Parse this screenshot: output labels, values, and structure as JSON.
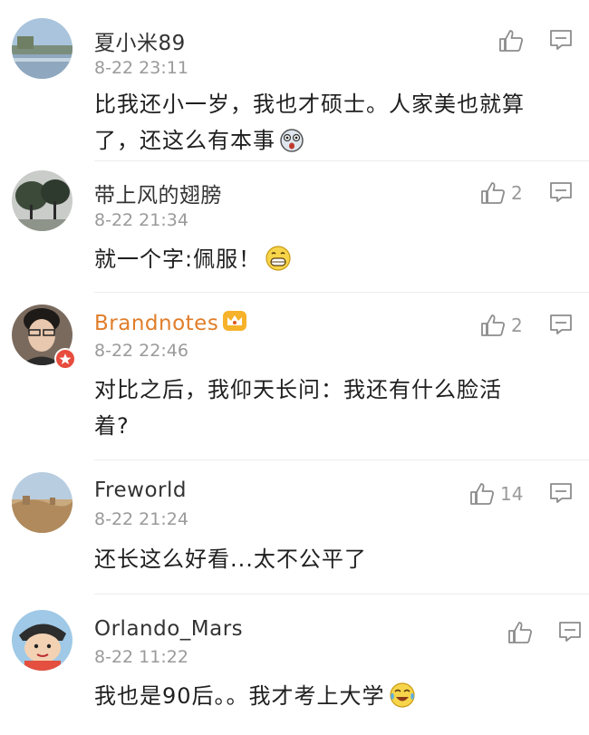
{
  "comments": [
    {
      "name": "夏小米89",
      "time": "8-22 23:11",
      "text": "比我还小一岁，我也才硕士。人家美也就算了，还这么有本事",
      "likes": "",
      "avatar": "lake-icon"
    },
    {
      "name": "带上风的翅膀",
      "time": "8-22 21:34",
      "text": "就一个字:佩服！",
      "likes": "2",
      "avatar": "trees-icon"
    },
    {
      "name": "Brandnotes",
      "time": "8-22 22:46",
      "text": "对比之后，我仰天长问：我还有什么脸活着?",
      "likes": "2",
      "avatar": "person-icon",
      "vip": true
    },
    {
      "name": "Freworld",
      "time": "8-22 21:24",
      "text": "还长这么好看...太不公平了",
      "likes": "14",
      "avatar": "desert-icon"
    },
    {
      "name": "Orlando_Mars",
      "time": "8-22 11:22",
      "text": "我也是90后。。我才考上大学",
      "likes": "",
      "avatar": "cartoon-icon"
    }
  ],
  "colors": {
    "name": "#333333",
    "vip_name": "#e07d2a",
    "time": "#9a9a9a",
    "text": "#1f1f1f",
    "icon": "#8c8c8c"
  }
}
